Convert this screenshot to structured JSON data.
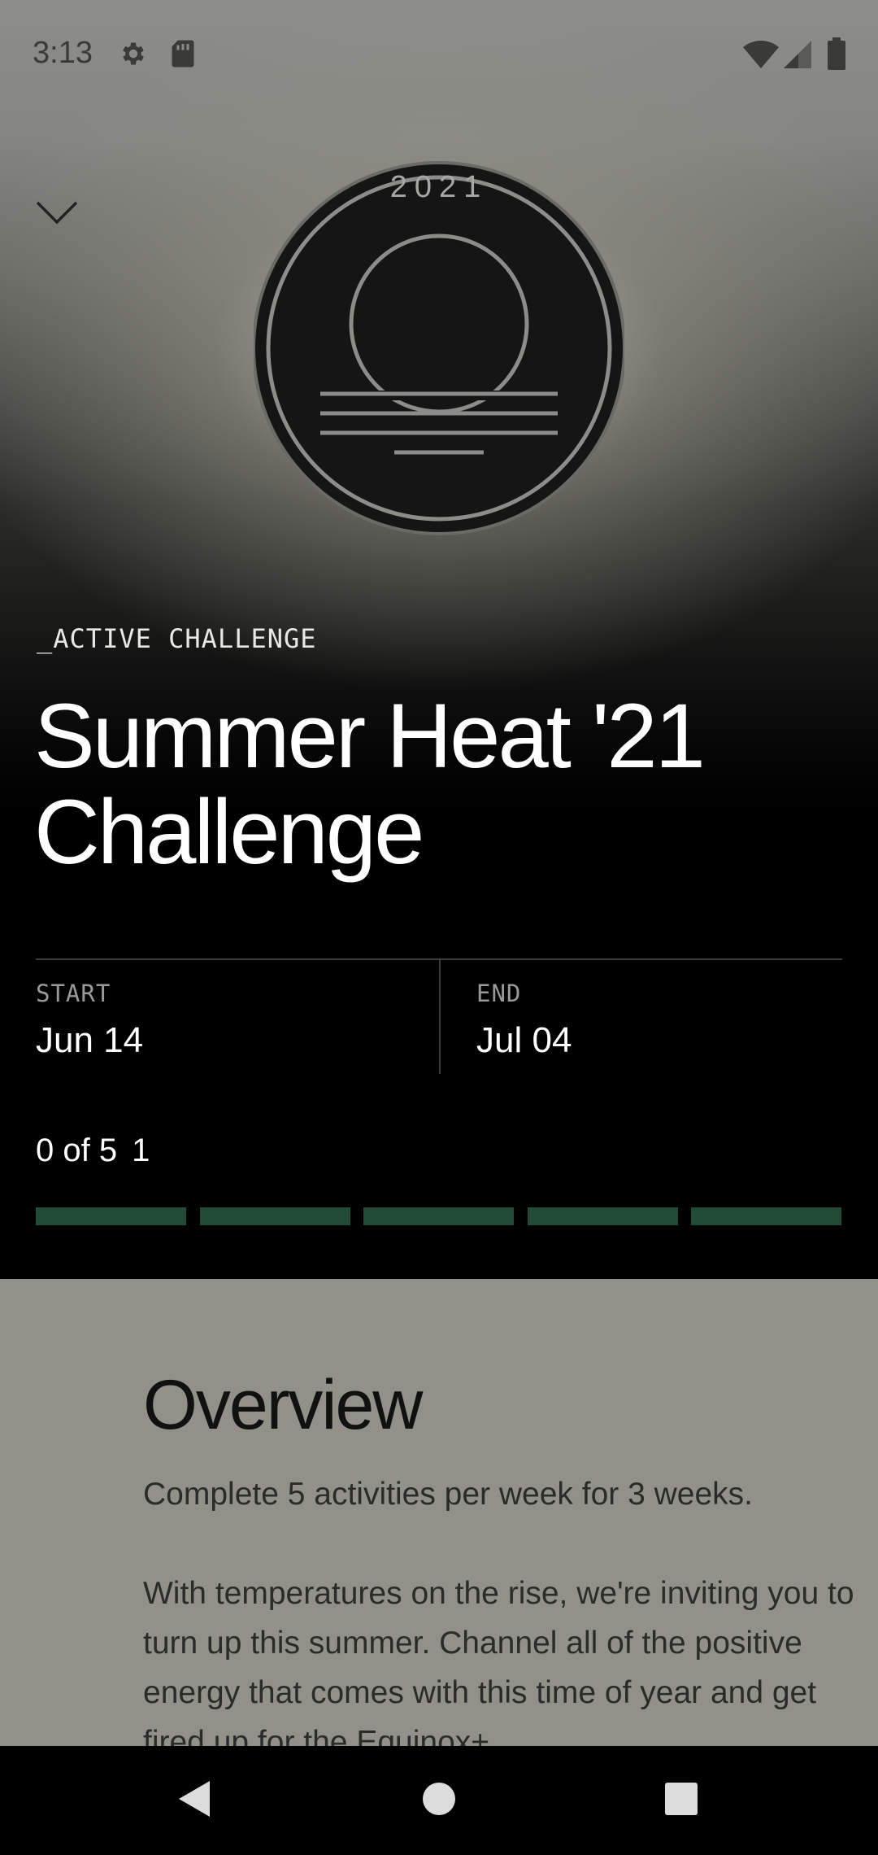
{
  "status_bar": {
    "time": "3:13",
    "icons": [
      "gear-icon",
      "sd-card-icon",
      "wifi-icon",
      "cell-signal-icon",
      "battery-icon"
    ]
  },
  "header": {
    "collapse_icon": "chevron-down-icon"
  },
  "badge": {
    "year": "2021",
    "icon": "sunset-icon"
  },
  "challenge": {
    "eyebrow": "_ACTIVE CHALLENGE",
    "title_line1": "Summer Heat '21",
    "title_line2": "Challenge",
    "start_label": "START",
    "start_value": "Jun 14",
    "end_label": "END",
    "end_value": "Jul 04",
    "progress_text": "0 of 5",
    "progress_extra": "1",
    "progress_segments": 5,
    "progress_completed": 0
  },
  "overview": {
    "title": "Overview",
    "summary": "Complete 5 activities per week for 3 weeks.",
    "body": "With temperatures on the rise, we're inviting you to turn up this summer. Channel all of the positive energy that comes with this time of year and get fired up for the Equinox+"
  },
  "nav_bar": {
    "back_icon": "back-triangle-icon",
    "home_icon": "home-circle-icon",
    "recents_icon": "recents-square-icon"
  },
  "colors": {
    "progress_segment": "#214b37",
    "overview_bg": "#91918a",
    "accent_text": "#ffffff"
  }
}
